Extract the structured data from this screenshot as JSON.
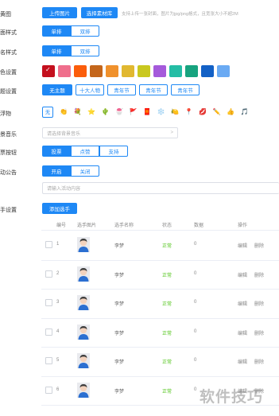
{
  "form": {
    "cover": {
      "label": "黄图",
      "upload_btn": "上传图片",
      "select_btn": "选择素材库",
      "hint": "支持上传一张封面，图片为jpg/png格式，且宽张大小不超2M"
    },
    "layout": {
      "label": "面样式",
      "options": [
        "单排",
        "双排"
      ],
      "selected": "单排"
    },
    "name_style": {
      "label": "名样式",
      "options": [
        "单排",
        "双排"
      ],
      "selected": "单排"
    },
    "color": {
      "label": "色设置",
      "selected_index": 0,
      "swatches": [
        "#c4101e",
        "#ef6e8c",
        "#fb5d0b",
        "#c4661b",
        "#f0912c",
        "#e1b830",
        "#c9c81f",
        "#a55adb",
        "#24bda5",
        "#17a37f",
        "#1361c6",
        "#6aaaf3"
      ]
    },
    "theme": {
      "label": "题设置",
      "options": [
        "无主题",
        "十大人物",
        "青年节",
        "青年节",
        "青年节"
      ],
      "selected": "无主题"
    },
    "gift": {
      "label": "浮物",
      "none_label": "无",
      "icons": [
        "👏",
        "💐",
        "⭐",
        "🌵",
        "🍧",
        "🚩",
        "🧧",
        "❄️",
        "🍋",
        "📍",
        "💋",
        "✏️",
        "👍",
        "🎵"
      ]
    },
    "music": {
      "label": "景音乐",
      "placeholder": "请选择背景音乐",
      "caret": ">"
    },
    "vote_btn": {
      "label": "票按钮",
      "options": [
        "投票",
        "点赞",
        "支持"
      ],
      "selected": "投票"
    },
    "notice": {
      "label": "动公告",
      "options": [
        "开启",
        "关闭"
      ],
      "selected": "开启",
      "placeholder": "请输入活动内容"
    },
    "players": {
      "label": "手设置",
      "add_btn": "添加选手",
      "columns": [
        "编号",
        "选手图片",
        "选手名称",
        "状态",
        "数据",
        "操作"
      ],
      "rows": [
        {
          "id": "1",
          "name": "李梦",
          "status": "正常",
          "data": "0",
          "edit": "编辑",
          "delete": "删除"
        },
        {
          "id": "2",
          "name": "李梦",
          "status": "正常",
          "data": "0",
          "edit": "编辑",
          "delete": "删除"
        },
        {
          "id": "3",
          "name": "李梦",
          "status": "正常",
          "data": "0",
          "edit": "编辑",
          "delete": "删除"
        },
        {
          "id": "4",
          "name": "李梦",
          "status": "正常",
          "data": "0",
          "edit": "编辑",
          "delete": "删除"
        },
        {
          "id": "5",
          "name": "李梦",
          "status": "正常",
          "data": "0",
          "edit": "编辑",
          "delete": "删除"
        },
        {
          "id": "6",
          "name": "李梦",
          "status": "正常",
          "data": "0",
          "edit": "编辑",
          "delete": "删除"
        }
      ]
    }
  },
  "watermark": "软件技巧",
  "colors": {
    "primary": "#1e88f5",
    "status_ok": "#52c41a",
    "border": "#dcdfe6"
  }
}
